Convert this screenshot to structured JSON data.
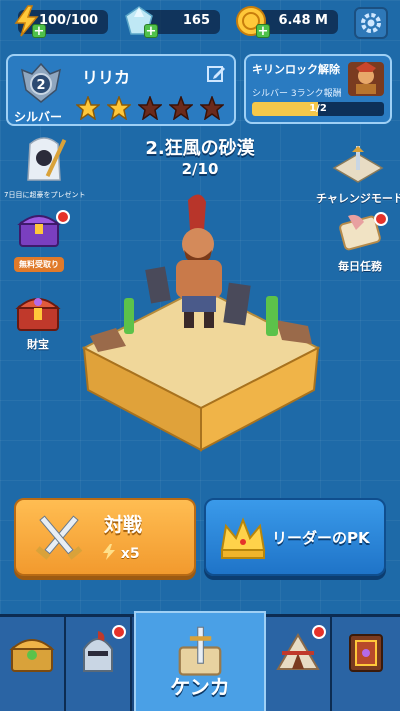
{
  "resources": {
    "energy": "100/100",
    "gems": "165",
    "gold": "6.48 M"
  },
  "player": {
    "name": "リリカ",
    "rank_number": "2",
    "rank_label": "シルバー",
    "stars_filled": 2,
    "stars_total": 5
  },
  "unlock": {
    "title": "キリンロック解除",
    "subtitle": "シルバー 3ランク報酬",
    "progress_text": "1/2",
    "progress": 0.5
  },
  "stage": {
    "title": "2.狂風の砂漠",
    "progress": "2/10"
  },
  "left_items": {
    "gift_label": "7日目に超豪をプレゼント",
    "chest_free_label": "無料受取り",
    "treasure_label": "財宝"
  },
  "right_items": {
    "challenge_label": "チャレンジモード",
    "daily_label": "毎日任務"
  },
  "buttons": {
    "battle_label": "対戦",
    "battle_cost": "x5",
    "pk_label": "リーダーのPK"
  },
  "nav": {
    "active_label": "ケンカ"
  },
  "colors": {
    "background": "#1e6aa8",
    "battle_button": "#f29a2e",
    "pk_button": "#1f74c8",
    "badge_red": "#e5322a"
  }
}
